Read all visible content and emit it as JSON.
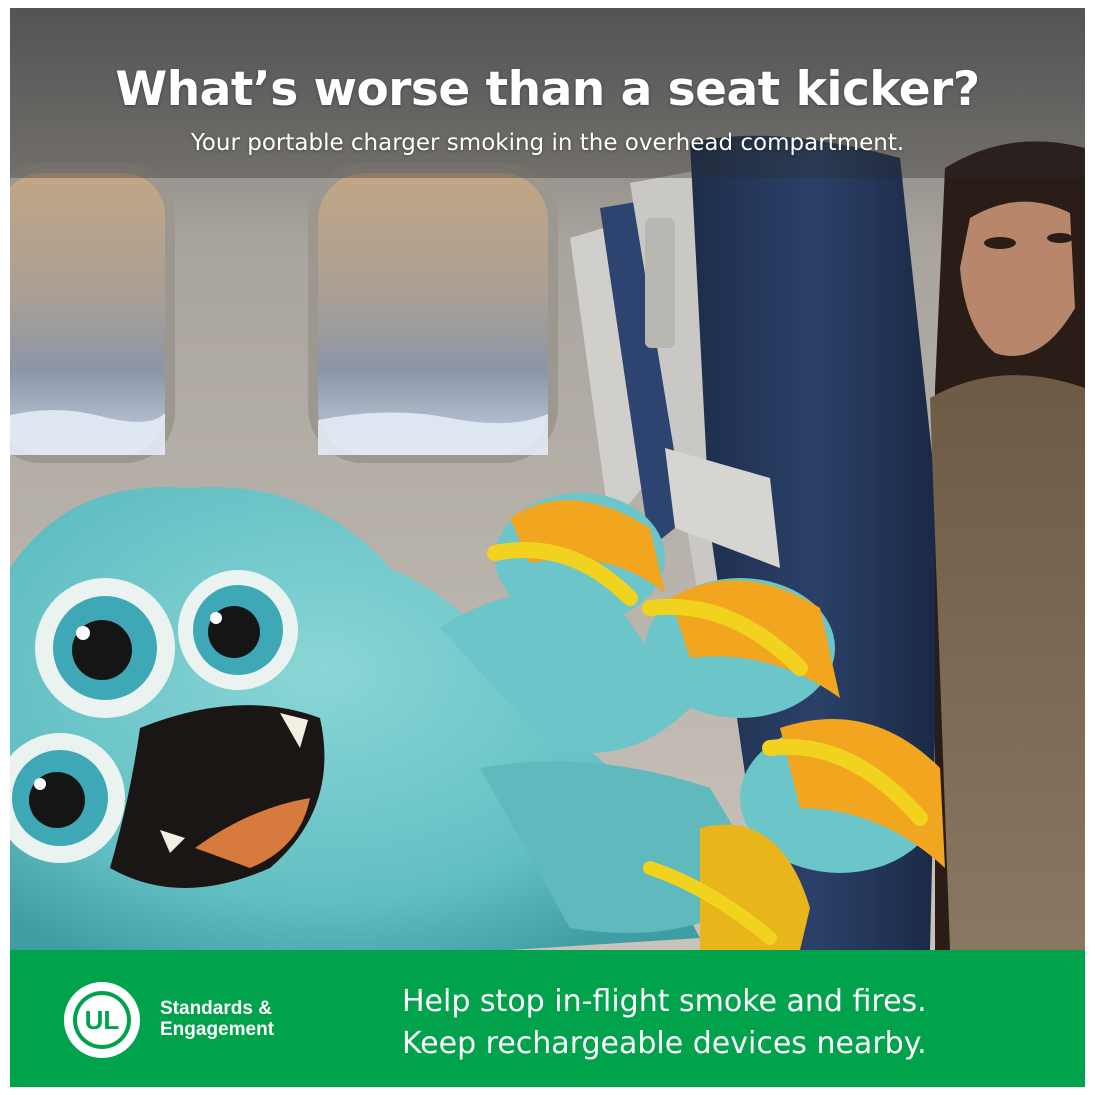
{
  "headline": "What’s worse than a seat kicker?",
  "subheadline": "Your portable charger smoking in the overhead compartment.",
  "footer": {
    "brand_line1": "Standards &",
    "brand_line2": "Engagement",
    "logo_text": "UL",
    "message_line1": "Help stop in-flight smoke and fires.",
    "message_line2": "Keep rechargeable devices nearby."
  },
  "colors": {
    "footer_green": "#00a24c",
    "monster_fur": "#6fc7c9",
    "sandal_yellow": "#f1c41f",
    "seat_navy": "#263a5c"
  },
  "icons": {
    "logo": "ul-logo-icon"
  }
}
